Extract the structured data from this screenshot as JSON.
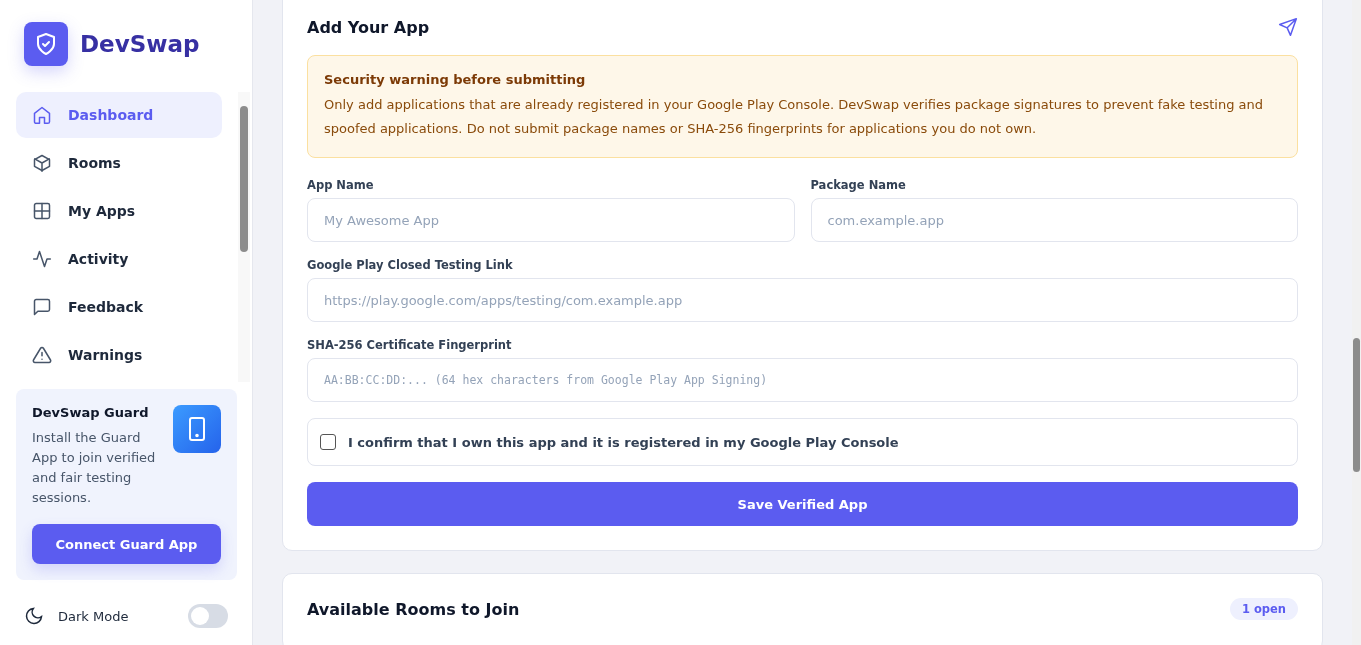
{
  "brand": {
    "name": "DevSwap"
  },
  "nav": [
    {
      "label": "Dashboard",
      "selected": true
    },
    {
      "label": "Rooms",
      "selected": false
    },
    {
      "label": "My Apps",
      "selected": false
    },
    {
      "label": "Activity",
      "selected": false
    },
    {
      "label": "Feedback",
      "selected": false
    },
    {
      "label": "Warnings",
      "selected": false
    }
  ],
  "guard": {
    "title": "DevSwap Guard",
    "text": "Install the Guard App to join verified and fair testing sessions.",
    "button": "Connect Guard App"
  },
  "dark_mode": {
    "label": "Dark Mode",
    "on": false
  },
  "form": {
    "title": "Add Your App",
    "warning": {
      "title": "Security warning before submitting",
      "text": "Only add applications that are already registered in your Google Play Console. DevSwap verifies package signatures to prevent fake testing and spoofed applications. Do not submit package names or SHA-256 fingerprints for applications you do not own."
    },
    "fields": [
      {
        "label": "App Name",
        "placeholder": "My Awesome App",
        "kind": "text"
      },
      {
        "label": "Package Name",
        "placeholder": "com.example.app",
        "kind": "text"
      },
      {
        "label": "Google Play Closed Testing Link",
        "placeholder": "https://play.google.com/apps/testing/com.example.app",
        "kind": "text"
      },
      {
        "label": "SHA-256 Certificate Fingerprint",
        "placeholder": "AA:BB:CC:DD:... (64 hex characters from Google Play App Signing)",
        "kind": "mono"
      }
    ],
    "confirm": {
      "label": "I confirm that I own this app and it is registered in my Google Play Console",
      "checked": false
    },
    "submit": "Save Verified App"
  },
  "rooms": {
    "title": "Available Rooms to Join",
    "badge": "1 open"
  }
}
